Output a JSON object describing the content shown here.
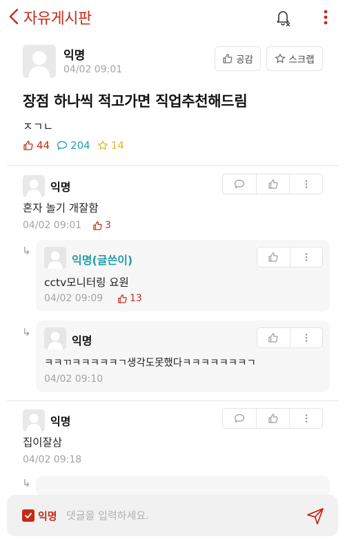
{
  "header": {
    "title": "자유게시판",
    "back_icon": "chevron-left-icon",
    "bell_icon": "bell-off-icon",
    "more_icon": "more-vertical-icon"
  },
  "colors": {
    "accent": "#c62917",
    "comment_teal": "#1f9ea8",
    "scrap_yellow": "#e1b82a",
    "meta_gray": "#a3a3a3"
  },
  "post": {
    "author": "익명",
    "time": "04/02 09:01",
    "like_button_label": "공감",
    "scrap_button_label": "스크랩",
    "title": "장점 하나씩 적고가면 직업추천해드림",
    "body": "ㅈㄱㄴ",
    "likes": "44",
    "comments": "204",
    "scraps": "14"
  },
  "comments": [
    {
      "author": "익명",
      "text": "혼자 놀기 개잘함",
      "time": "04/02 09:01",
      "likes": "3"
    },
    {
      "author": "익명",
      "text": "집이잘삼",
      "time": "04/02 09:18"
    }
  ],
  "replies": [
    {
      "author": "익명(글쓴이)",
      "text": "cctv모니터링 요원",
      "time": "04/02 09:09",
      "likes": "13"
    },
    {
      "author": "익명",
      "text": "ㅋㅋㄲㅋㅋㅋㅋㅋㄱ생각도못했다ㅋㅋㅋㅋㅋㅋㅋㄱ",
      "time": "04/02 09:10"
    }
  ],
  "composer": {
    "anonymous_label": "익명",
    "placeholder": "댓글을 입력하세요.",
    "anonymous_checked": true
  }
}
